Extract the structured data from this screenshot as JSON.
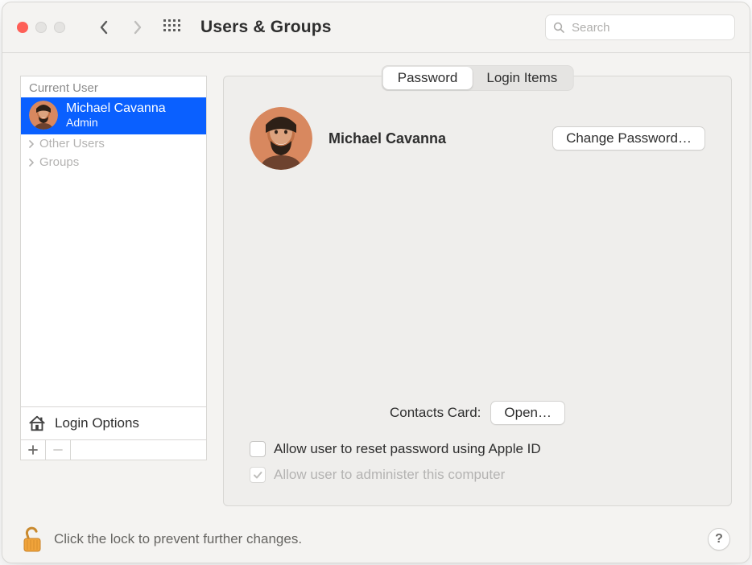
{
  "window": {
    "title": "Users & Groups",
    "search_placeholder": "Search"
  },
  "sidebar": {
    "current_user_label": "Current User",
    "user": {
      "name": "Michael Cavanna",
      "role": "Admin"
    },
    "items": [
      {
        "label": "Other Users"
      },
      {
        "label": "Groups"
      }
    ],
    "login_options_label": "Login Options"
  },
  "tabs": {
    "password": "Password",
    "login_items": "Login Items",
    "active": "password"
  },
  "profile": {
    "name": "Michael Cavanna",
    "change_password_label": "Change Password…"
  },
  "contacts": {
    "label": "Contacts Card:",
    "open_label": "Open…"
  },
  "checkboxes": {
    "reset_apple_id": "Allow user to reset password using Apple ID",
    "admin": "Allow user to administer this computer"
  },
  "footer": {
    "lock_text": "Click the lock to prevent further changes."
  }
}
